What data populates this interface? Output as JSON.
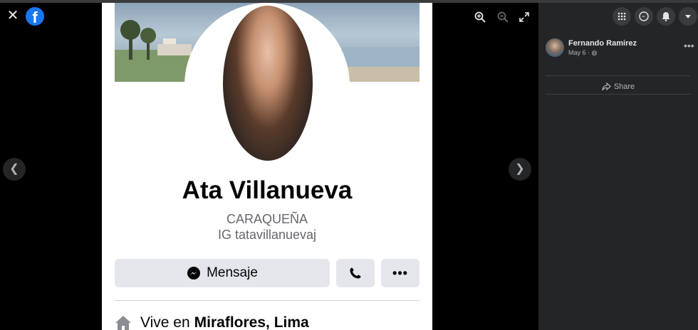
{
  "viewer": {
    "close_icon": "close-icon",
    "logo_icon": "facebook-logo-icon",
    "zoom_in_icon": "zoom-in-icon",
    "zoom_out_icon": "zoom-out-icon",
    "fullscreen_icon": "fullscreen-icon",
    "prev_icon": "chevron-left-icon",
    "next_icon": "chevron-right-icon"
  },
  "profile": {
    "name": "Ata Villanueva",
    "bio_line1": "CARAQUEÑA",
    "bio_line2": "IG  tatavillanuevaj",
    "message_label": "Mensaje",
    "lives_prefix": "Vive en",
    "lives_place": "Miraflores, Lima"
  },
  "sidebar": {
    "author_name": "Fernando Ramirez",
    "post_date": "May 6 ·",
    "share_label": "Share"
  },
  "colors": {
    "brand": "#1877f2",
    "panel_bg": "#242526",
    "button_bg": "#e4e6eb"
  }
}
